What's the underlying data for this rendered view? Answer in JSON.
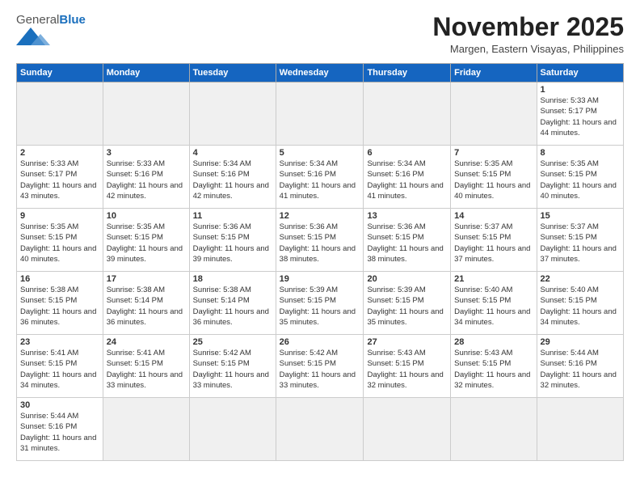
{
  "header": {
    "logo_general": "General",
    "logo_blue": "Blue",
    "month_title": "November 2025",
    "subtitle": "Margen, Eastern Visayas, Philippines"
  },
  "days_of_week": [
    "Sunday",
    "Monday",
    "Tuesday",
    "Wednesday",
    "Thursday",
    "Friday",
    "Saturday"
  ],
  "weeks": [
    [
      {
        "day": "",
        "empty": true
      },
      {
        "day": "",
        "empty": true
      },
      {
        "day": "",
        "empty": true
      },
      {
        "day": "",
        "empty": true
      },
      {
        "day": "",
        "empty": true
      },
      {
        "day": "",
        "empty": true
      },
      {
        "day": "1",
        "sunrise": "Sunrise: 5:33 AM",
        "sunset": "Sunset: 5:17 PM",
        "daylight": "Daylight: 11 hours and 44 minutes."
      }
    ],
    [
      {
        "day": "2",
        "sunrise": "Sunrise: 5:33 AM",
        "sunset": "Sunset: 5:17 PM",
        "daylight": "Daylight: 11 hours and 43 minutes."
      },
      {
        "day": "3",
        "sunrise": "Sunrise: 5:33 AM",
        "sunset": "Sunset: 5:16 PM",
        "daylight": "Daylight: 11 hours and 42 minutes."
      },
      {
        "day": "4",
        "sunrise": "Sunrise: 5:34 AM",
        "sunset": "Sunset: 5:16 PM",
        "daylight": "Daylight: 11 hours and 42 minutes."
      },
      {
        "day": "5",
        "sunrise": "Sunrise: 5:34 AM",
        "sunset": "Sunset: 5:16 PM",
        "daylight": "Daylight: 11 hours and 41 minutes."
      },
      {
        "day": "6",
        "sunrise": "Sunrise: 5:34 AM",
        "sunset": "Sunset: 5:16 PM",
        "daylight": "Daylight: 11 hours and 41 minutes."
      },
      {
        "day": "7",
        "sunrise": "Sunrise: 5:35 AM",
        "sunset": "Sunset: 5:15 PM",
        "daylight": "Daylight: 11 hours and 40 minutes."
      },
      {
        "day": "8",
        "sunrise": "Sunrise: 5:35 AM",
        "sunset": "Sunset: 5:15 PM",
        "daylight": "Daylight: 11 hours and 40 minutes."
      }
    ],
    [
      {
        "day": "9",
        "sunrise": "Sunrise: 5:35 AM",
        "sunset": "Sunset: 5:15 PM",
        "daylight": "Daylight: 11 hours and 40 minutes."
      },
      {
        "day": "10",
        "sunrise": "Sunrise: 5:35 AM",
        "sunset": "Sunset: 5:15 PM",
        "daylight": "Daylight: 11 hours and 39 minutes."
      },
      {
        "day": "11",
        "sunrise": "Sunrise: 5:36 AM",
        "sunset": "Sunset: 5:15 PM",
        "daylight": "Daylight: 11 hours and 39 minutes."
      },
      {
        "day": "12",
        "sunrise": "Sunrise: 5:36 AM",
        "sunset": "Sunset: 5:15 PM",
        "daylight": "Daylight: 11 hours and 38 minutes."
      },
      {
        "day": "13",
        "sunrise": "Sunrise: 5:36 AM",
        "sunset": "Sunset: 5:15 PM",
        "daylight": "Daylight: 11 hours and 38 minutes."
      },
      {
        "day": "14",
        "sunrise": "Sunrise: 5:37 AM",
        "sunset": "Sunset: 5:15 PM",
        "daylight": "Daylight: 11 hours and 37 minutes."
      },
      {
        "day": "15",
        "sunrise": "Sunrise: 5:37 AM",
        "sunset": "Sunset: 5:15 PM",
        "daylight": "Daylight: 11 hours and 37 minutes."
      }
    ],
    [
      {
        "day": "16",
        "sunrise": "Sunrise: 5:38 AM",
        "sunset": "Sunset: 5:15 PM",
        "daylight": "Daylight: 11 hours and 36 minutes."
      },
      {
        "day": "17",
        "sunrise": "Sunrise: 5:38 AM",
        "sunset": "Sunset: 5:14 PM",
        "daylight": "Daylight: 11 hours and 36 minutes."
      },
      {
        "day": "18",
        "sunrise": "Sunrise: 5:38 AM",
        "sunset": "Sunset: 5:14 PM",
        "daylight": "Daylight: 11 hours and 36 minutes."
      },
      {
        "day": "19",
        "sunrise": "Sunrise: 5:39 AM",
        "sunset": "Sunset: 5:15 PM",
        "daylight": "Daylight: 11 hours and 35 minutes."
      },
      {
        "day": "20",
        "sunrise": "Sunrise: 5:39 AM",
        "sunset": "Sunset: 5:15 PM",
        "daylight": "Daylight: 11 hours and 35 minutes."
      },
      {
        "day": "21",
        "sunrise": "Sunrise: 5:40 AM",
        "sunset": "Sunset: 5:15 PM",
        "daylight": "Daylight: 11 hours and 34 minutes."
      },
      {
        "day": "22",
        "sunrise": "Sunrise: 5:40 AM",
        "sunset": "Sunset: 5:15 PM",
        "daylight": "Daylight: 11 hours and 34 minutes."
      }
    ],
    [
      {
        "day": "23",
        "sunrise": "Sunrise: 5:41 AM",
        "sunset": "Sunset: 5:15 PM",
        "daylight": "Daylight: 11 hours and 34 minutes."
      },
      {
        "day": "24",
        "sunrise": "Sunrise: 5:41 AM",
        "sunset": "Sunset: 5:15 PM",
        "daylight": "Daylight: 11 hours and 33 minutes."
      },
      {
        "day": "25",
        "sunrise": "Sunrise: 5:42 AM",
        "sunset": "Sunset: 5:15 PM",
        "daylight": "Daylight: 11 hours and 33 minutes."
      },
      {
        "day": "26",
        "sunrise": "Sunrise: 5:42 AM",
        "sunset": "Sunset: 5:15 PM",
        "daylight": "Daylight: 11 hours and 33 minutes."
      },
      {
        "day": "27",
        "sunrise": "Sunrise: 5:43 AM",
        "sunset": "Sunset: 5:15 PM",
        "daylight": "Daylight: 11 hours and 32 minutes."
      },
      {
        "day": "28",
        "sunrise": "Sunrise: 5:43 AM",
        "sunset": "Sunset: 5:15 PM",
        "daylight": "Daylight: 11 hours and 32 minutes."
      },
      {
        "day": "29",
        "sunrise": "Sunrise: 5:44 AM",
        "sunset": "Sunset: 5:16 PM",
        "daylight": "Daylight: 11 hours and 32 minutes."
      }
    ],
    [
      {
        "day": "30",
        "sunrise": "Sunrise: 5:44 AM",
        "sunset": "Sunset: 5:16 PM",
        "daylight": "Daylight: 11 hours and 31 minutes."
      },
      {
        "day": "",
        "empty": true
      },
      {
        "day": "",
        "empty": true
      },
      {
        "day": "",
        "empty": true
      },
      {
        "day": "",
        "empty": true
      },
      {
        "day": "",
        "empty": true
      },
      {
        "day": "",
        "empty": true
      }
    ]
  ]
}
